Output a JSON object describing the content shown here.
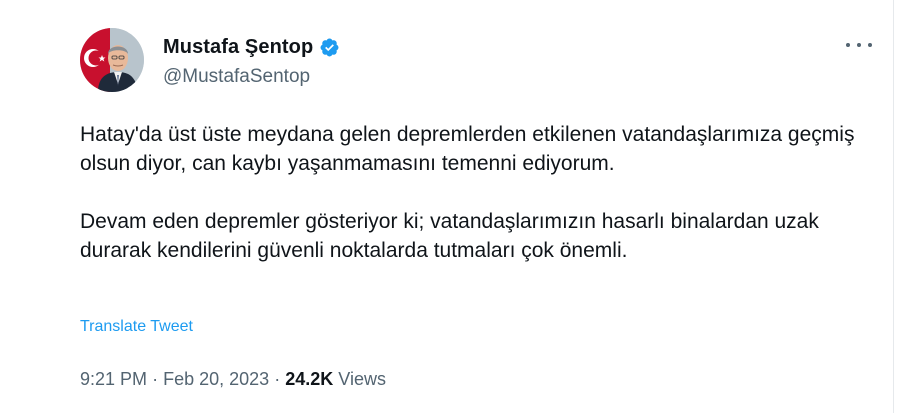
{
  "tweet": {
    "author": {
      "display_name": "Mustafa Şentop",
      "handle": "@MustafaSentop",
      "verified_icon": "verified-badge-icon"
    },
    "more_icon": "more-options-icon",
    "paragraphs": [
      "Hatay'da üst üste meydana gelen depremlerden etkilenen vatandaşlarımıza geçmiş olsun diyor, can kaybı yaşanmamasını temenni ediyorum.",
      "Devam eden depremler gösteriyor ki; vatandaşlarımızın hasarlı binalardan uzak durarak kendilerini güvenli noktalarda tutmaları çok önemli."
    ],
    "translate_label": "Translate Tweet",
    "time": "9:21 PM",
    "separator": "·",
    "date": "Feb 20, 2023",
    "views_count": "24.2K",
    "views_label": "Views"
  },
  "colors": {
    "accent": "#1d9bf0",
    "text_primary": "#0f1419",
    "text_secondary": "#536471"
  }
}
